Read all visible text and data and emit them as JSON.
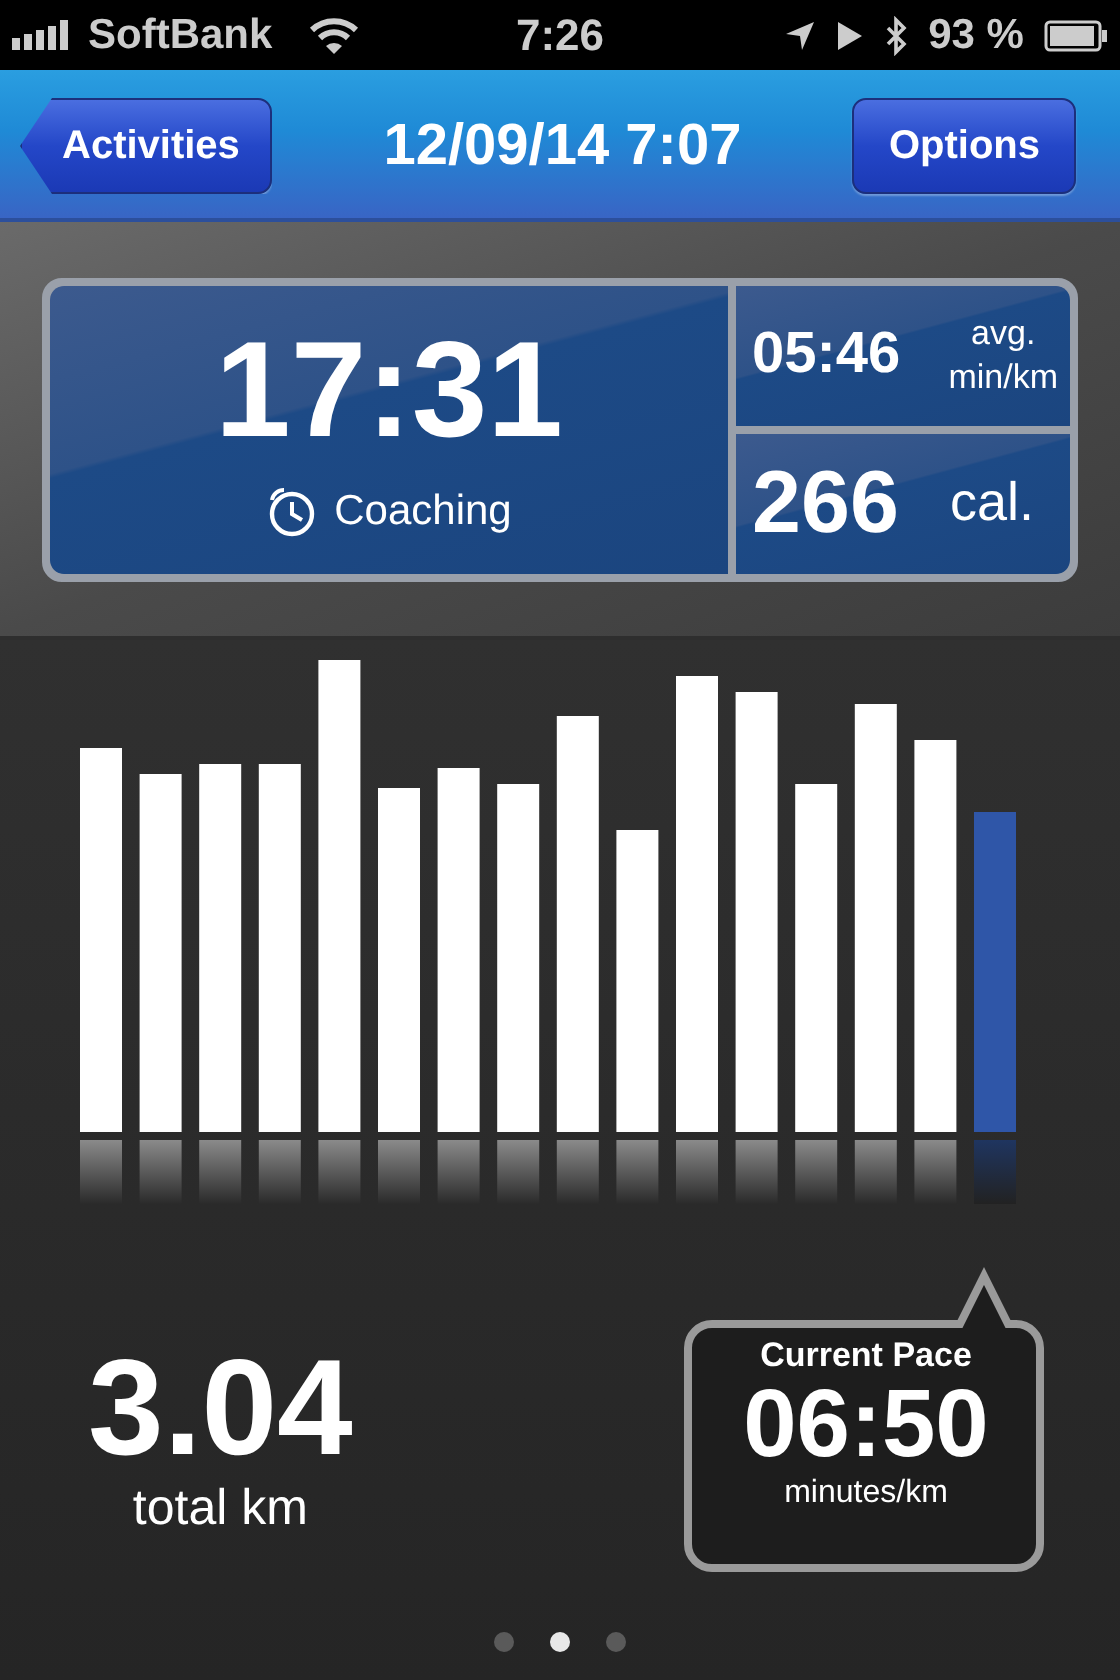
{
  "status_bar": {
    "carrier": "SoftBank",
    "time": "7:26",
    "battery": "93 %"
  },
  "nav_bar": {
    "back": "Activities",
    "title": "12/09/14 7:07",
    "action": "Options"
  },
  "summary": {
    "duration": "17:31",
    "mode": "Coaching",
    "avg_pace": "05:46",
    "avg_label": "avg.",
    "avg_unit": "min/km",
    "calories": "266",
    "calories_unit": "cal."
  },
  "distance": {
    "value": "3.04",
    "label": "total km"
  },
  "current_pace": {
    "title": "Current Pace",
    "value": "06:50",
    "unit": "minutes/km"
  },
  "pages": [
    {
      "selected": false
    },
    {
      "selected": true
    },
    {
      "selected": false
    }
  ]
}
